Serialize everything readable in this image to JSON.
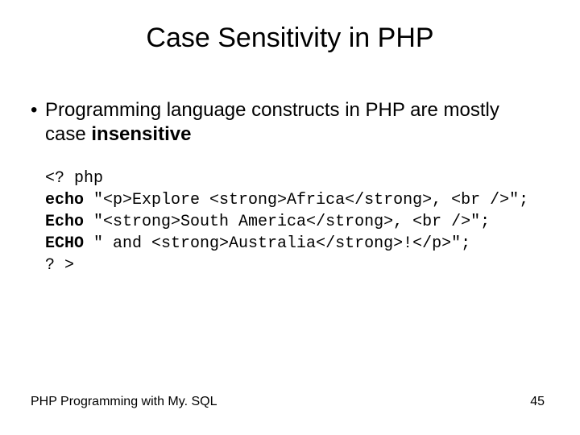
{
  "title": "Case Sensitivity in PHP",
  "bullet": {
    "dot": "•",
    "pre": "Programming language constructs in PHP are mostly case ",
    "emph": "insensitive"
  },
  "code": {
    "l1": "<? php",
    "l2a": "echo",
    "l2b": " \"<p>Explore <strong>Africa</strong>, <br />\";",
    "l3a": "Echo",
    "l3b": " \"<strong>South America</strong>, <br />\";",
    "l4a": "ECHO",
    "l4b": " \" and <strong>Australia</strong>!</p>\";",
    "l5": "? >"
  },
  "footer": {
    "left": "PHP Programming with My. SQL",
    "right": "45"
  }
}
